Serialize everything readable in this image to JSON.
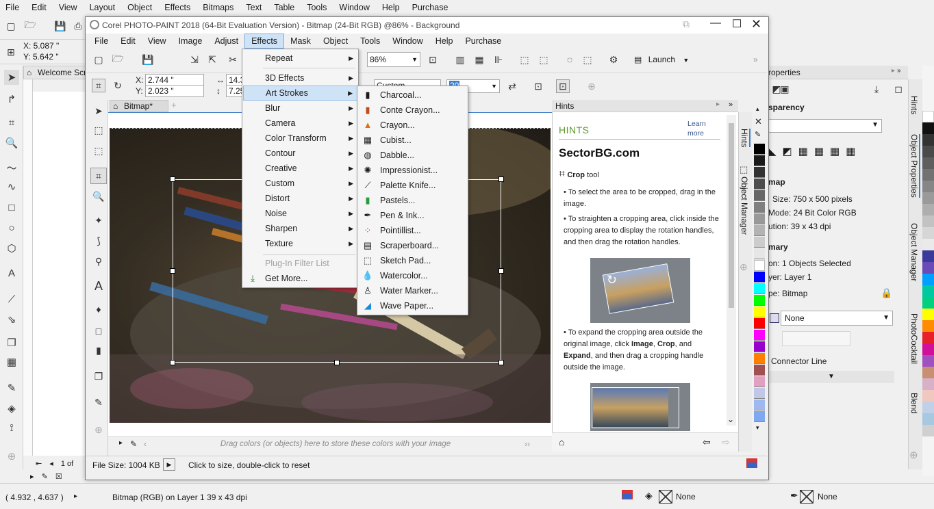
{
  "outer_menu": [
    "File",
    "Edit",
    "View",
    "Layout",
    "Object",
    "Effects",
    "Bitmaps",
    "Text",
    "Table",
    "Tools",
    "Window",
    "Help",
    "Purchase"
  ],
  "outer_coords": {
    "x": "X: 5.087 \"",
    "y": "Y: 5.642 \""
  },
  "welcome_tab": "Welcome Scr",
  "window": {
    "title": "Corel PHOTO-PAINT 2018 (64-Bit Evaluation Version) - Bitmap (24-Bit RGB) @86% - Background"
  },
  "inner_menu": [
    "File",
    "Edit",
    "View",
    "Image",
    "Adjust",
    "Effects",
    "Mask",
    "Object",
    "Tools",
    "Window",
    "Help",
    "Purchase"
  ],
  "toolbar": {
    "zoom": "86%",
    "launch": "Launch"
  },
  "propbar": {
    "x": "2.744 \"",
    "y": "2.023 \"",
    "w": "14.3",
    "h": "7.25",
    "custom": "Custom",
    "dpi": "20"
  },
  "doc_tab": "Bitmap*",
  "palette_hint": "Drag colors (or objects) here to store these colors with your image",
  "status": {
    "file_size": "File Size: 1004 KB",
    "message": "Click to size, double-click to reset"
  },
  "effects_menu": {
    "items": [
      "Repeat",
      "3D Effects",
      "Art Strokes",
      "Blur",
      "Camera",
      "Color Transform",
      "Contour",
      "Creative",
      "Custom",
      "Distort",
      "Noise",
      "Sharpen",
      "Texture"
    ],
    "plugin": "Plug-In Filter List",
    "get_more": "Get More..."
  },
  "art_strokes_menu": [
    "Charcoal...",
    "Conte Crayon...",
    "Crayon...",
    "Cubist...",
    "Dabble...",
    "Impressionist...",
    "Palette Knife...",
    "Pastels...",
    "Pen & Ink...",
    "Pointillist...",
    "Scraperboard...",
    "Sketch Pad...",
    "Watercolor...",
    "Water Marker...",
    "Wave Paper..."
  ],
  "hints": {
    "panel_title": "Hints",
    "heading": "HINTS",
    "learn_more": "Learn more",
    "site": "SectorBG.com",
    "tool_name": "Crop",
    "tool_suffix": " tool",
    "p1": "• To select the area to be cropped, drag in the image.",
    "p2": "• To straighten a cropping area, click inside the cropping area to display the rotation handles, and then drag the rotation handles.",
    "p3a": "• To expand the cropping area outside the original image, click ",
    "p3b": "Image",
    "p3c": ", ",
    "p3d": "Crop",
    "p3e": ", and ",
    "p3f": "Expand",
    "p3g": ", and then drag a cropping handle outside the image."
  },
  "docker_tabs": {
    "hints": "Hints",
    "object_manager": "Object Manager"
  },
  "properties": {
    "title": "roperties",
    "transparency": "sparency",
    "bitmap_heading": "map",
    "size": "Size:  750 x 500 pixels",
    "mode": "Mode:  24 Bit Color  RGB",
    "resolution": "ution:  39 x 43 dpi",
    "summary_heading": "mary",
    "selection": "on:  1 Objects Selected",
    "layer": "yer:  Layer 1",
    "type": "pe:  Bitmap",
    "none_dropdown": "None",
    "connector": "Connector Line"
  },
  "right_tabs": [
    "Object Properties",
    "Object Manager",
    "PhotoCocktail",
    "Blend"
  ],
  "outer_status": {
    "coords": "( 4.932 , 4.637 )",
    "object_info": "Bitmap (RGB) on Layer 1 39 x 43 dpi",
    "fill": "None",
    "outline": "None"
  },
  "page_nav": "1  of",
  "colors": {
    "accent": "#3c7fc8",
    "menu_highlight": "#cfe3f7",
    "hints_green": "#5a9a28"
  }
}
